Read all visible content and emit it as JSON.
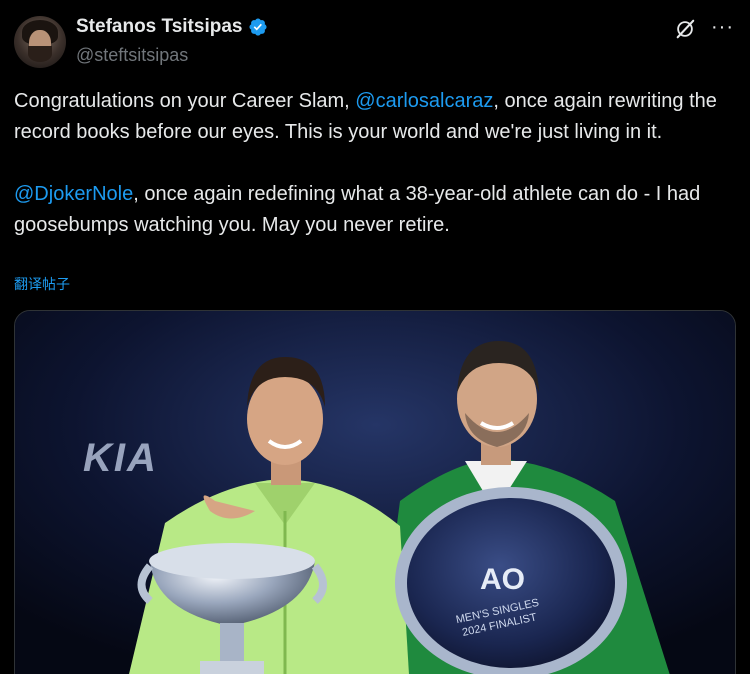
{
  "user": {
    "display_name": "Stefanos Tsitsipas",
    "handle": "@steftsitsipas",
    "verified": true
  },
  "icons": [
    "avatar",
    "verified-badge-icon",
    "grok-icon",
    "more-icon"
  ],
  "post": {
    "line1_pre": "Congratulations on your Career Slam, ",
    "mention1": "@carlosalcaraz",
    "line1_post": ", once again rewriting the record books before our eyes. This is your world and we're just living in it.",
    "mention2": "@DjokerNole",
    "line2_post": ", once again redefining what a 38-year-old athlete can do - I had goosebumps watching you. May you never retire.",
    "translate_label": "翻译帖子"
  },
  "media": {
    "sponsor_text": "KIA",
    "plate_logo": "AO",
    "plate_line1": "MEN'S SINGLES",
    "plate_line2": "2024 FINALIST"
  },
  "colors": {
    "background": "#000000",
    "text": "#e7e9ea",
    "muted": "#71767b",
    "accent": "#1d9bf0"
  }
}
